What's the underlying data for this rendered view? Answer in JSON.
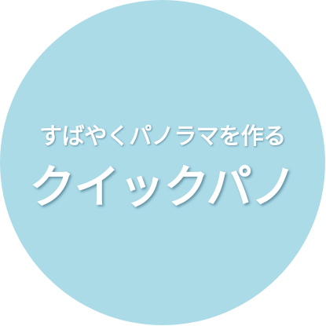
{
  "badge": {
    "background_color": "#acdbe8",
    "text_color": "#ffffff",
    "tagline": "すばやくパノラマを作る",
    "title": "クイックパノ"
  }
}
